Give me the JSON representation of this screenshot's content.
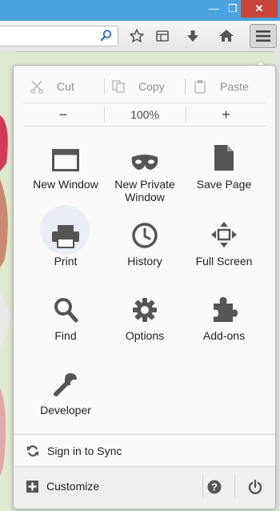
{
  "window": {
    "minimize_glyph": "—",
    "maximize_glyph": "❐",
    "close_glyph": "✕"
  },
  "toolbar": {
    "icons": [
      "search-icon",
      "star-icon",
      "reading-list-icon",
      "download-icon",
      "home-icon",
      "hamburger-menu-icon"
    ]
  },
  "menu": {
    "edit": {
      "cut": "Cut",
      "copy": "Copy",
      "paste": "Paste"
    },
    "zoom": {
      "out": "−",
      "level": "100%",
      "in": "+"
    },
    "tiles": [
      {
        "label": "New Window",
        "icon": "window-icon"
      },
      {
        "label": "New Private Window",
        "icon": "mask-icon"
      },
      {
        "label": "Save Page",
        "icon": "page-icon"
      },
      {
        "label": "Print",
        "icon": "printer-icon"
      },
      {
        "label": "History",
        "icon": "clock-icon"
      },
      {
        "label": "Full Screen",
        "icon": "fullscreen-icon"
      },
      {
        "label": "Find",
        "icon": "magnifier-icon"
      },
      {
        "label": "Options",
        "icon": "gear-icon"
      },
      {
        "label": "Add-ons",
        "icon": "puzzle-icon"
      },
      {
        "label": "Developer",
        "icon": "wrench-icon"
      }
    ],
    "sync_label": "Sign in to Sync",
    "customize_label": "Customize",
    "footer_icons": [
      "help-icon",
      "power-icon"
    ]
  },
  "colors": {
    "titlebar": "#4aa3df",
    "close_button": "#c9453a",
    "icon_gray": "#555555",
    "disabled_gray": "#8f8f8f",
    "highlight_circle": "#e9edf5"
  }
}
